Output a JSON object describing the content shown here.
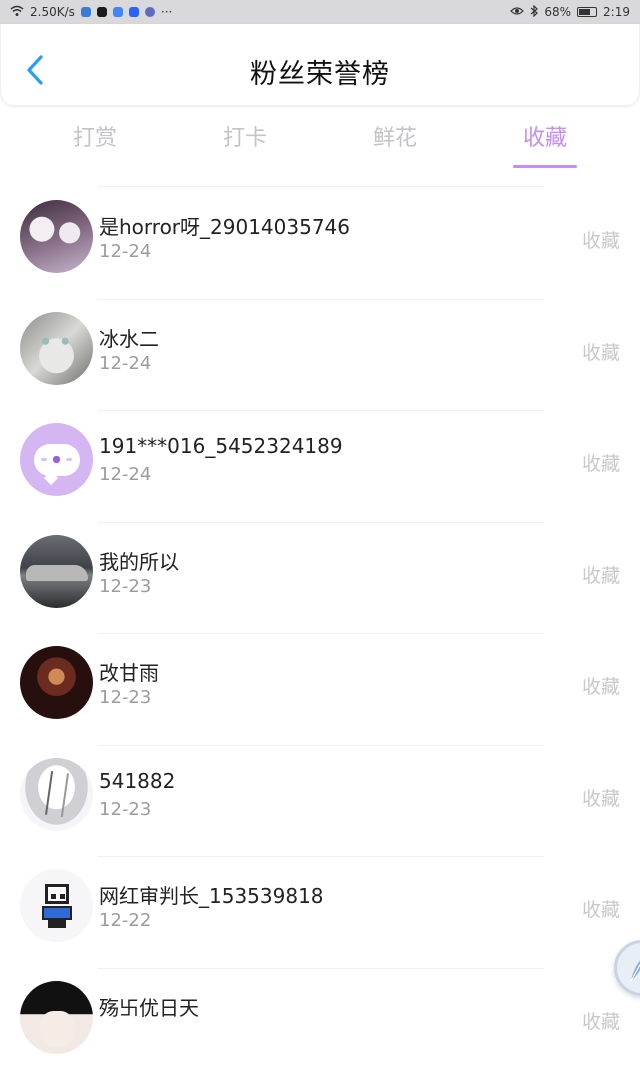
{
  "status_bar": {
    "network_speed": "2.50K/s",
    "battery": "68%",
    "time": "2:19",
    "more": "···"
  },
  "header": {
    "title": "粉丝荣誉榜"
  },
  "tabs": [
    {
      "label": "打赏",
      "active": false
    },
    {
      "label": "打卡",
      "active": false
    },
    {
      "label": "鲜花",
      "active": false
    },
    {
      "label": "收藏",
      "active": true
    }
  ],
  "fans": [
    {
      "name": "是horror呀_29014035746",
      "date": "12-24",
      "action": "收藏",
      "avatar": "horror-avatar"
    },
    {
      "name": "冰水二",
      "date": "12-24",
      "action": "收藏",
      "avatar": "snow-leopard-avatar"
    },
    {
      "name": "191***016_5452324189",
      "date": "12-24",
      "action": "收藏",
      "avatar": "default-chat-avatar"
    },
    {
      "name": "我的所以",
      "date": "12-23",
      "action": "收藏",
      "avatar": "sports-car-avatar"
    },
    {
      "name": "改甘雨",
      "date": "12-23",
      "action": "收藏",
      "avatar": "dark-warrior-avatar"
    },
    {
      "name": "541882",
      "date": "12-23",
      "action": "收藏",
      "avatar": "sketch-character-avatar"
    },
    {
      "name": "网红审判长_153539818",
      "date": "12-22",
      "action": "收藏",
      "avatar": "pixel-skeleton-avatar"
    },
    {
      "name": "殇卐优日天",
      "date": "",
      "action": "收藏",
      "avatar": "anime-boy-avatar"
    }
  ],
  "colors": {
    "accent": "#c58ef0",
    "back_arrow": "#2a9df4",
    "inactive_tab": "#c4c4c8",
    "action_text": "#c9c9cd"
  }
}
